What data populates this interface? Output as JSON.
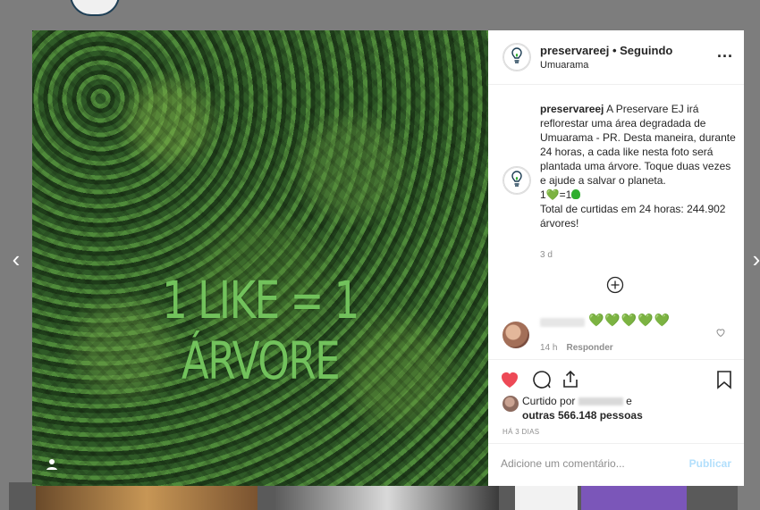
{
  "post": {
    "overlay_text": "1 LIKE = 1 ÁRVORE",
    "username": "preservareej",
    "follow_text": "• Seguindo",
    "location": "Umuarama",
    "more": "...",
    "caption": {
      "username": "preservareej",
      "lines": [
        " A Preservare EJ irá reflorestar uma área degradada de Umuarama - PR. Desta maneira, durante 24 horas, a cada like nesta foto será plantada uma árvore. Toque duas vezes e ajude a salvar o planeta."
      ],
      "eq_left": "1",
      "eq_mid": "=1",
      "total": "Total de curtidas em 24 horas: 244.902 árvores!",
      "time": "3 d"
    },
    "comment": {
      "hearts": "💚💚💚💚💚",
      "time": "14 h",
      "reply": "Responder"
    },
    "likes": {
      "prefix": "Curtido por",
      "and": "e",
      "others": "outras 566.148 pessoas"
    },
    "posted": "HÁ 3 DIAS",
    "add_comment_placeholder": "Adicione um comentário...",
    "publish": "Publicar"
  },
  "icons": {
    "nav_left": "chevron-left-icon",
    "nav_right": "chevron-right-icon",
    "like": "heart-filled-icon",
    "comment": "comment-icon",
    "share": "share-icon",
    "save": "bookmark-icon",
    "load_more": "plus-circle-icon",
    "tagged_user": "user-icon"
  },
  "colors": {
    "like_red": "#ed4956",
    "overlay_green": "#72c25c",
    "heart_green": "#2eae2e",
    "publish_blue": "#b2dffc"
  }
}
